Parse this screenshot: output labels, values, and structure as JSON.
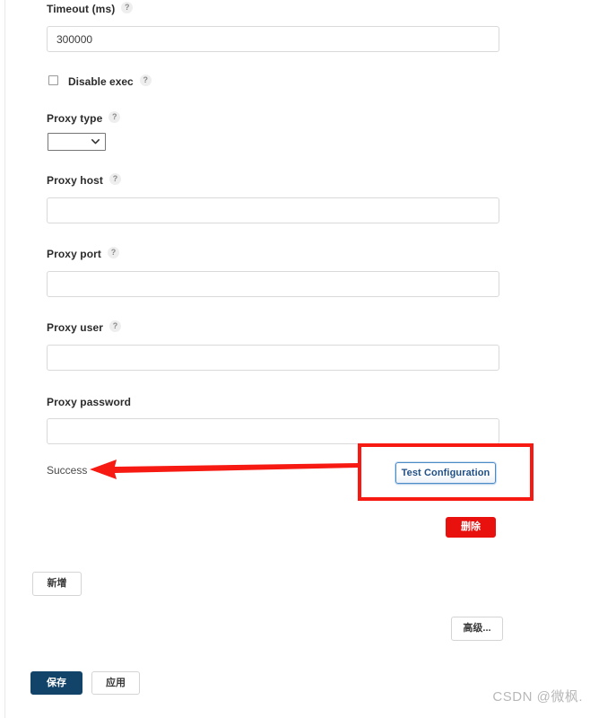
{
  "fields": [
    {
      "label": "Timeout (ms)",
      "help": "?",
      "has_help": true,
      "value": "300000",
      "placeholder": ""
    },
    {
      "label": "Proxy host",
      "help": "?",
      "has_help": true,
      "value": "",
      "placeholder": ""
    },
    {
      "label": "Proxy port",
      "help": "?",
      "has_help": true,
      "value": "",
      "placeholder": ""
    },
    {
      "label": "Proxy user",
      "help": "?",
      "has_help": true,
      "value": "",
      "placeholder": ""
    },
    {
      "label": "Proxy password",
      "help": "",
      "has_help": false,
      "value": "",
      "placeholder": ""
    }
  ],
  "checkbox": {
    "label": "Disable exec",
    "help": "?",
    "checked": false
  },
  "proxy_type": {
    "label": "Proxy type",
    "help": "?",
    "selected": "",
    "icon": "chevron-down-icon"
  },
  "status": {
    "text": "Success"
  },
  "test_button": {
    "label": "Test Configuration"
  },
  "buttons": {
    "delete": "删除",
    "add": "新增",
    "advanced": "高级...",
    "save": "保存",
    "apply": "应用"
  },
  "annotation": {
    "box_color": "#f61a12",
    "arrow_color": "#f61a12",
    "arrow_name": "red-arrow-pointing-to-success"
  },
  "watermark": {
    "text": "CSDN @微枫."
  },
  "colors": {
    "accent_blue": "#1f4f86",
    "save_blue": "#124368",
    "danger_red": "#e8110e",
    "annotation_red": "#f61a12"
  }
}
